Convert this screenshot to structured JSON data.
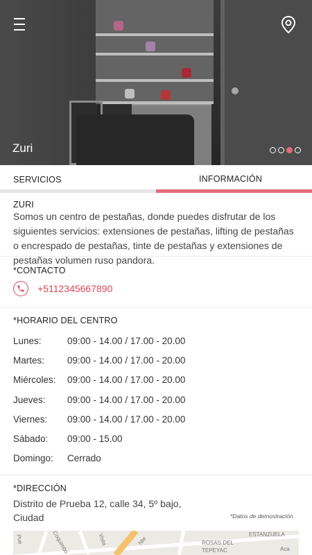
{
  "hero": {
    "title": "Zuri",
    "slide_count": 4,
    "active_slide": 3,
    "menu_icon": "hamburger-menu-icon",
    "location_icon": "map-pin-icon"
  },
  "tabs": [
    {
      "label": "SERVICIOS",
      "active": false
    },
    {
      "label": "INFORMACIÓN",
      "active": true
    }
  ],
  "info": {
    "name": "ZURI",
    "description": "Somos un centro de pestañas, donde puedes disfrutar de los siguientes servicios: extensiones de pestañas, lifting de pestañas o encrespado de pestañas, tinte de pestañas y extensiones de pestañas volumen ruso pandora."
  },
  "contact": {
    "title": "*CONTACTO",
    "phone": "+5112345667890",
    "icon": "phone-icon"
  },
  "schedule": {
    "title": "*HORARIO DEL CENTRO",
    "days": [
      {
        "day": "Lunes:",
        "hours": "09:00 - 14.00  /  17.00 - 20.00"
      },
      {
        "day": "Martes:",
        "hours": "09:00 - 14.00  /  17.00 - 20.00"
      },
      {
        "day": "Miércoles:",
        "hours": "09:00 - 14.00  /  17.00 - 20.00"
      },
      {
        "day": "Jueves:",
        "hours": "09:00 - 14.00  /  17.00 - 20.00"
      },
      {
        "day": "Viernes:",
        "hours": "09:00 - 14.00  /  17.00 - 20.00"
      },
      {
        "day": "Sábado:",
        "hours": "09:00 - 15.00"
      },
      {
        "day": "Domingo:",
        "hours": "Cerrado"
      }
    ]
  },
  "address": {
    "title": "*DIRECCIÓN",
    "text": "Distrito de Prueba 12, calle 34, 5º bajo, Ciudad",
    "demo_note": "*Datos de demostración"
  },
  "map": {
    "labels": [
      "ESTANZUELA",
      "ROSAS DEL",
      "TEPEYAC",
      "Coquimbo",
      "Vista",
      "Nte",
      "Pue",
      "Aca"
    ]
  },
  "colors": {
    "accent": "#e56b7b",
    "phone": "#d9475a",
    "tab_inactive_bar": "#e6e6e6"
  }
}
